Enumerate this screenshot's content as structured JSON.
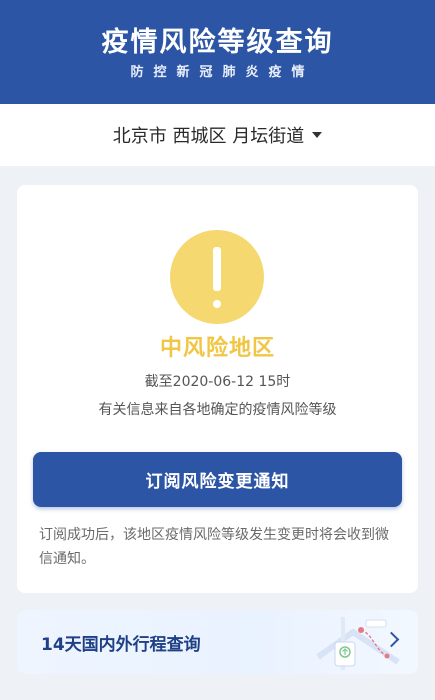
{
  "header": {
    "title": "疫情风险等级查询",
    "subtitle": "防控新冠肺炎疫情"
  },
  "location": {
    "text": "北京市 西城区 月坛街道"
  },
  "risk": {
    "icon": "warning-icon",
    "level": "中风险地区",
    "as_of": "截至2020-06-12 15时",
    "source": "有关信息来自各地确定的疫情风险等级",
    "color": "#f5d970"
  },
  "subscribe": {
    "button_label": "订阅风险变更通知",
    "note": "订阅成功后，该地区疫情风险等级发生变更时将会收到微信通知。"
  },
  "trip": {
    "label": "14天国内外行程查询",
    "icon": "route-map-icon"
  },
  "colors": {
    "brand": "#2d55a5",
    "warning": "#f5d970"
  }
}
